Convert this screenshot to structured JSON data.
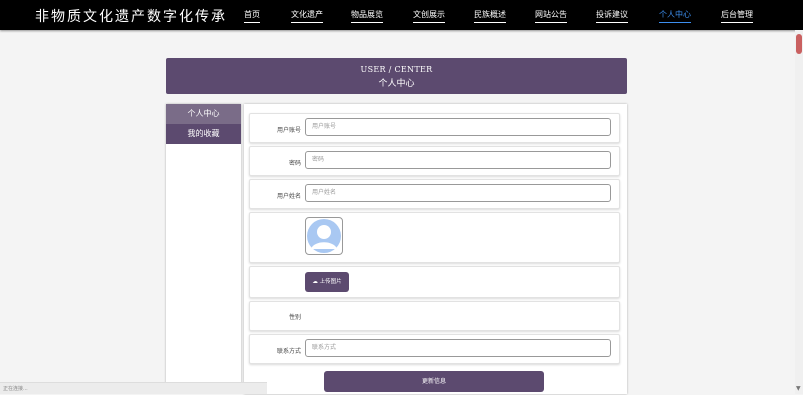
{
  "site": {
    "title": "非物质文化遗产数字化传承"
  },
  "nav": {
    "items": [
      "首页",
      "文化遗产",
      "物品展览",
      "文创展示",
      "民族概述",
      "网站公告",
      "投诉建议",
      "个人中心",
      "后台管理"
    ],
    "active": "个人中心",
    "active_color": "#3d8ff0"
  },
  "banner": {
    "en": "USER / CENTER",
    "cn": "个人中心"
  },
  "sidebar": {
    "items": [
      "个人中心",
      "我的收藏"
    ]
  },
  "form": {
    "account": {
      "label": "用户账号",
      "placeholder": "用户账号"
    },
    "password": {
      "label": "密码",
      "placeholder": "密码"
    },
    "name": {
      "label": "用户姓名",
      "placeholder": "用户姓名"
    },
    "upload_label": "上传图片",
    "upload_icon": "cloud-upload-icon",
    "gender": {
      "label": "性别"
    },
    "phone": {
      "label": "联系方式",
      "placeholder": "联系方式"
    },
    "update_label": "更新信息"
  },
  "status": {
    "text": "正在连接..."
  },
  "colors": {
    "accent": "#5c4a6f",
    "nav_bg": "#000000",
    "avatar": "#a9c8f2"
  }
}
